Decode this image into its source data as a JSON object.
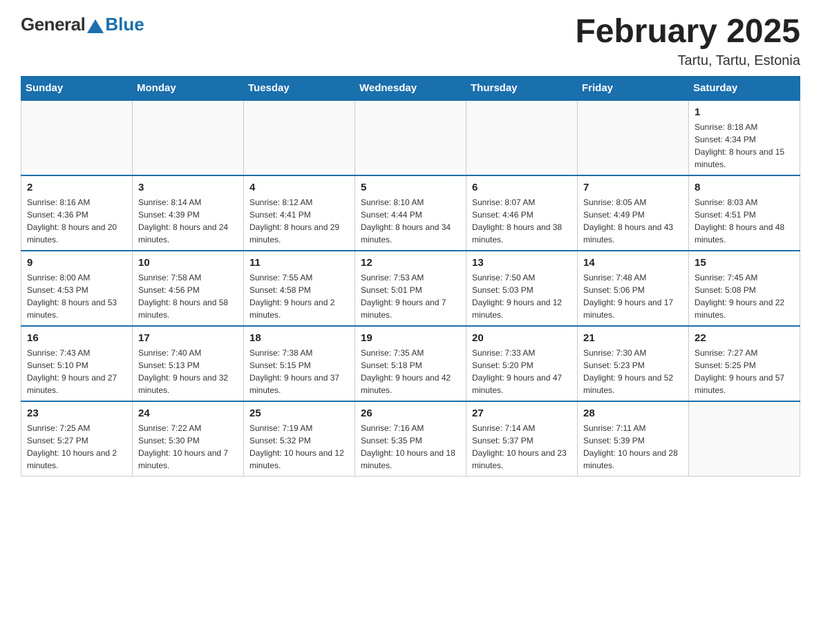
{
  "logo": {
    "general": "General",
    "blue": "Blue",
    "sub": ""
  },
  "header": {
    "month": "February 2025",
    "location": "Tartu, Tartu, Estonia"
  },
  "weekdays": [
    "Sunday",
    "Monday",
    "Tuesday",
    "Wednesday",
    "Thursday",
    "Friday",
    "Saturday"
  ],
  "weeks": [
    [
      {
        "day": "",
        "info": ""
      },
      {
        "day": "",
        "info": ""
      },
      {
        "day": "",
        "info": ""
      },
      {
        "day": "",
        "info": ""
      },
      {
        "day": "",
        "info": ""
      },
      {
        "day": "",
        "info": ""
      },
      {
        "day": "1",
        "info": "Sunrise: 8:18 AM\nSunset: 4:34 PM\nDaylight: 8 hours and 15 minutes."
      }
    ],
    [
      {
        "day": "2",
        "info": "Sunrise: 8:16 AM\nSunset: 4:36 PM\nDaylight: 8 hours and 20 minutes."
      },
      {
        "day": "3",
        "info": "Sunrise: 8:14 AM\nSunset: 4:39 PM\nDaylight: 8 hours and 24 minutes."
      },
      {
        "day": "4",
        "info": "Sunrise: 8:12 AM\nSunset: 4:41 PM\nDaylight: 8 hours and 29 minutes."
      },
      {
        "day": "5",
        "info": "Sunrise: 8:10 AM\nSunset: 4:44 PM\nDaylight: 8 hours and 34 minutes."
      },
      {
        "day": "6",
        "info": "Sunrise: 8:07 AM\nSunset: 4:46 PM\nDaylight: 8 hours and 38 minutes."
      },
      {
        "day": "7",
        "info": "Sunrise: 8:05 AM\nSunset: 4:49 PM\nDaylight: 8 hours and 43 minutes."
      },
      {
        "day": "8",
        "info": "Sunrise: 8:03 AM\nSunset: 4:51 PM\nDaylight: 8 hours and 48 minutes."
      }
    ],
    [
      {
        "day": "9",
        "info": "Sunrise: 8:00 AM\nSunset: 4:53 PM\nDaylight: 8 hours and 53 minutes."
      },
      {
        "day": "10",
        "info": "Sunrise: 7:58 AM\nSunset: 4:56 PM\nDaylight: 8 hours and 58 minutes."
      },
      {
        "day": "11",
        "info": "Sunrise: 7:55 AM\nSunset: 4:58 PM\nDaylight: 9 hours and 2 minutes."
      },
      {
        "day": "12",
        "info": "Sunrise: 7:53 AM\nSunset: 5:01 PM\nDaylight: 9 hours and 7 minutes."
      },
      {
        "day": "13",
        "info": "Sunrise: 7:50 AM\nSunset: 5:03 PM\nDaylight: 9 hours and 12 minutes."
      },
      {
        "day": "14",
        "info": "Sunrise: 7:48 AM\nSunset: 5:06 PM\nDaylight: 9 hours and 17 minutes."
      },
      {
        "day": "15",
        "info": "Sunrise: 7:45 AM\nSunset: 5:08 PM\nDaylight: 9 hours and 22 minutes."
      }
    ],
    [
      {
        "day": "16",
        "info": "Sunrise: 7:43 AM\nSunset: 5:10 PM\nDaylight: 9 hours and 27 minutes."
      },
      {
        "day": "17",
        "info": "Sunrise: 7:40 AM\nSunset: 5:13 PM\nDaylight: 9 hours and 32 minutes."
      },
      {
        "day": "18",
        "info": "Sunrise: 7:38 AM\nSunset: 5:15 PM\nDaylight: 9 hours and 37 minutes."
      },
      {
        "day": "19",
        "info": "Sunrise: 7:35 AM\nSunset: 5:18 PM\nDaylight: 9 hours and 42 minutes."
      },
      {
        "day": "20",
        "info": "Sunrise: 7:33 AM\nSunset: 5:20 PM\nDaylight: 9 hours and 47 minutes."
      },
      {
        "day": "21",
        "info": "Sunrise: 7:30 AM\nSunset: 5:23 PM\nDaylight: 9 hours and 52 minutes."
      },
      {
        "day": "22",
        "info": "Sunrise: 7:27 AM\nSunset: 5:25 PM\nDaylight: 9 hours and 57 minutes."
      }
    ],
    [
      {
        "day": "23",
        "info": "Sunrise: 7:25 AM\nSunset: 5:27 PM\nDaylight: 10 hours and 2 minutes."
      },
      {
        "day": "24",
        "info": "Sunrise: 7:22 AM\nSunset: 5:30 PM\nDaylight: 10 hours and 7 minutes."
      },
      {
        "day": "25",
        "info": "Sunrise: 7:19 AM\nSunset: 5:32 PM\nDaylight: 10 hours and 12 minutes."
      },
      {
        "day": "26",
        "info": "Sunrise: 7:16 AM\nSunset: 5:35 PM\nDaylight: 10 hours and 18 minutes."
      },
      {
        "day": "27",
        "info": "Sunrise: 7:14 AM\nSunset: 5:37 PM\nDaylight: 10 hours and 23 minutes."
      },
      {
        "day": "28",
        "info": "Sunrise: 7:11 AM\nSunset: 5:39 PM\nDaylight: 10 hours and 28 minutes."
      },
      {
        "day": "",
        "info": ""
      }
    ]
  ]
}
